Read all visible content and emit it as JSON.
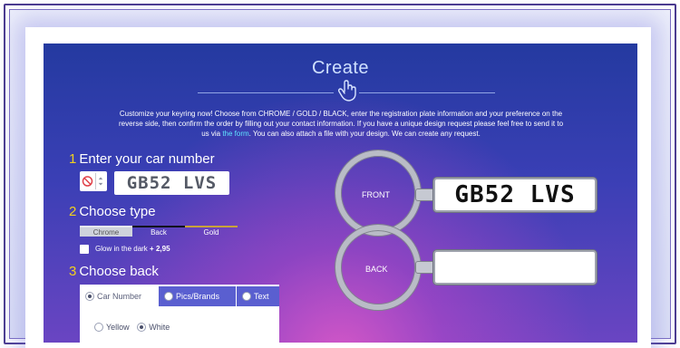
{
  "page": {
    "title": "Create",
    "intro_part1": "Customize your keyring now! Choose from CHROME / GOLD / BLACK, enter the registration plate information and your preference on the reverse side, then confirm the order by filling out your contact information. If you have a unique design request please feel free to send it to us via ",
    "intro_link": "the form",
    "intro_part2": ". You can also attach a file with your design. We can create any request."
  },
  "step1": {
    "num": "1",
    "title": "Enter your car number",
    "plate_value": "GB52 LVS"
  },
  "step2": {
    "num": "2",
    "title": "Choose type",
    "types": [
      "Chrome",
      "Back",
      "Gold"
    ],
    "glow_label": "Glow in the dark",
    "glow_price": "+ 2,95"
  },
  "step3": {
    "num": "3",
    "title": "Choose back",
    "tabs": [
      "Car Number",
      "Pics/Brands",
      "Text"
    ],
    "colors": [
      "Yellow",
      "White"
    ]
  },
  "preview": {
    "front_label": "FRONT",
    "back_label": "BACK",
    "front_plate": "GB52 LVS"
  }
}
